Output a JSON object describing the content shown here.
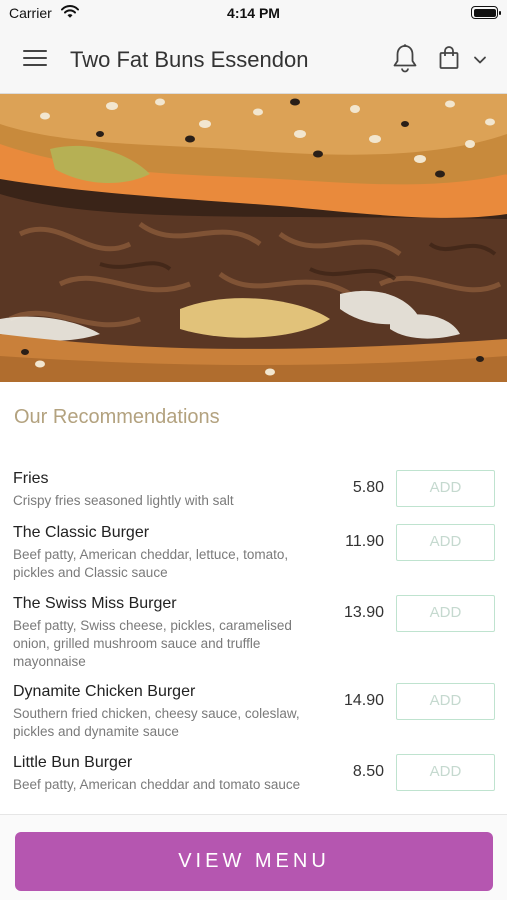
{
  "status_bar": {
    "carrier": "Carrier",
    "time": "4:14 PM"
  },
  "header": {
    "title": "Two Fat Buns Essendon"
  },
  "hero": {
    "image": "pulled-pork-burger-photo"
  },
  "recommendations": {
    "title": "Our Recommendations",
    "add_label": "ADD",
    "items": [
      {
        "name": "Fries",
        "description": "Crispy fries seasoned lightly with salt",
        "price": "5.80"
      },
      {
        "name": "The Classic Burger",
        "description": "Beef patty, American cheddar, lettuce, tomato, pickles and Classic sauce",
        "price": "11.90"
      },
      {
        "name": "The Swiss Miss Burger",
        "description": "Beef patty, Swiss cheese, pickles, caramelised onion, grilled mushroom sauce and truffle mayonnaise",
        "price": "13.90"
      },
      {
        "name": "Dynamite Chicken Burger",
        "description": "Southern fried chicken, cheesy sauce, coleslaw, pickles and dynamite sauce",
        "price": "14.90"
      },
      {
        "name": "Little Bun Burger",
        "description": "Beef patty, American cheddar and tomato sauce",
        "price": "8.50"
      }
    ]
  },
  "bottom": {
    "view_menu_label": "VIEW MENU"
  },
  "colors": {
    "accent": "#b556b0",
    "section_title": "#b3a27f",
    "add_border": "#bfe3cf"
  }
}
